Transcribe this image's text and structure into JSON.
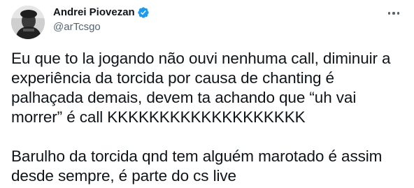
{
  "tweet": {
    "display_name": "Andrei Piovezan",
    "handle": "@arTcsgo",
    "verified_icon": "verified-badge-icon",
    "more_icon": "more-options-icon",
    "text": "Eu que to la jogando não ouvi nenhuma call, diminuir a experiência da torcida por causa de chanting é palhaçada demais, devem ta achando que “uh vai morrer” é call KKKKKKKKKKKKKKKKKKK\n\nBarulho da torcida qnd tem alguém marotado é assim desde sempre, é parte do cs live"
  },
  "colors": {
    "text_primary": "#0f1419",
    "text_secondary": "#536471",
    "verified_blue": "#1d9bf0"
  }
}
